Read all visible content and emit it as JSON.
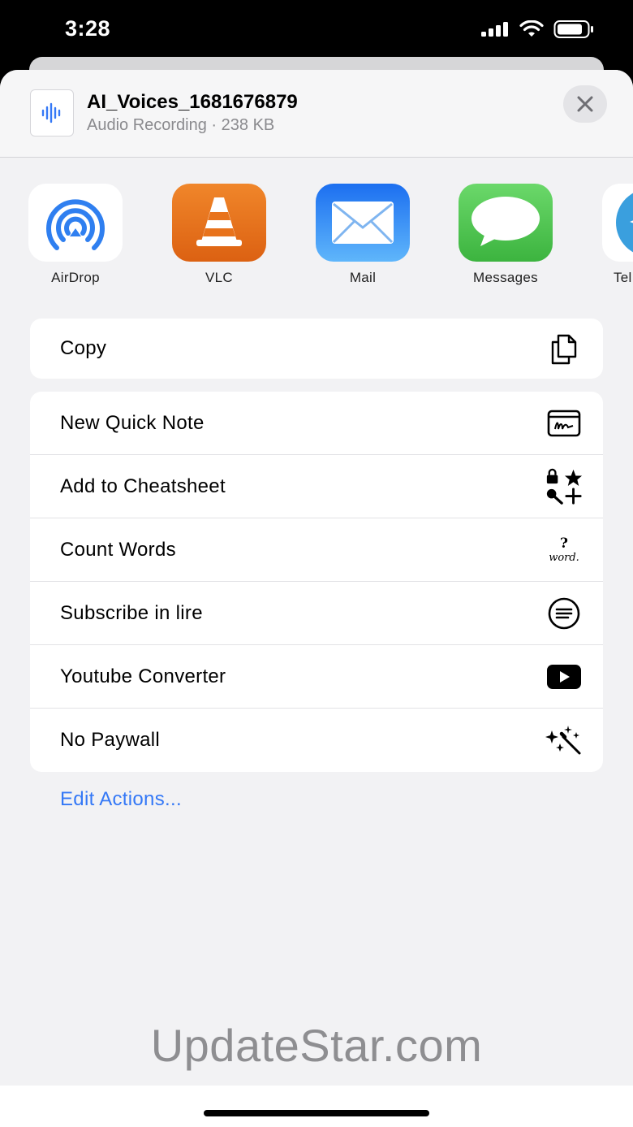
{
  "status_bar": {
    "time": "3:28",
    "icons": [
      "cellular-signal-icon",
      "wifi-icon",
      "battery-icon"
    ]
  },
  "header": {
    "file_name": "AI_Voices_1681676879",
    "file_meta": "Audio Recording · 238 KB",
    "file_icon": "audio-waveform-icon",
    "close_icon": "close-icon"
  },
  "apps": [
    {
      "label": "AirDrop",
      "icon": "airdrop-icon"
    },
    {
      "label": "VLC",
      "icon": "vlc-cone-icon"
    },
    {
      "label": "Mail",
      "icon": "mail-envelope-icon"
    },
    {
      "label": "Messages",
      "icon": "messages-bubble-icon"
    },
    {
      "label": "Tel",
      "icon": "telegram-icon"
    }
  ],
  "copy_group": [
    {
      "label": "Copy",
      "icon": "copy-icon"
    }
  ],
  "actions": [
    {
      "label": "New Quick Note",
      "icon": "quick-note-icon"
    },
    {
      "label": "Add to Cheatsheet",
      "icon": "cheatsheet-icon"
    },
    {
      "label": "Count Words",
      "icon": "count-words-icon",
      "icon_text_top": "?",
      "icon_text_bottom": "word."
    },
    {
      "label": "Subscribe in lire",
      "icon": "list-circle-icon"
    },
    {
      "label": "Youtube Converter",
      "icon": "youtube-play-icon"
    },
    {
      "label": "No Paywall",
      "icon": "magic-wand-icon"
    }
  ],
  "edit_actions": "Edit Actions...",
  "watermark": "UpdateStar.com",
  "colors": {
    "accent_blue": "#3478f6",
    "vlc_orange": "#e8731c",
    "mail_blue": "#2f8cf5",
    "messages_green": "#4fc552",
    "telegram_blue": "#3a9fde"
  }
}
